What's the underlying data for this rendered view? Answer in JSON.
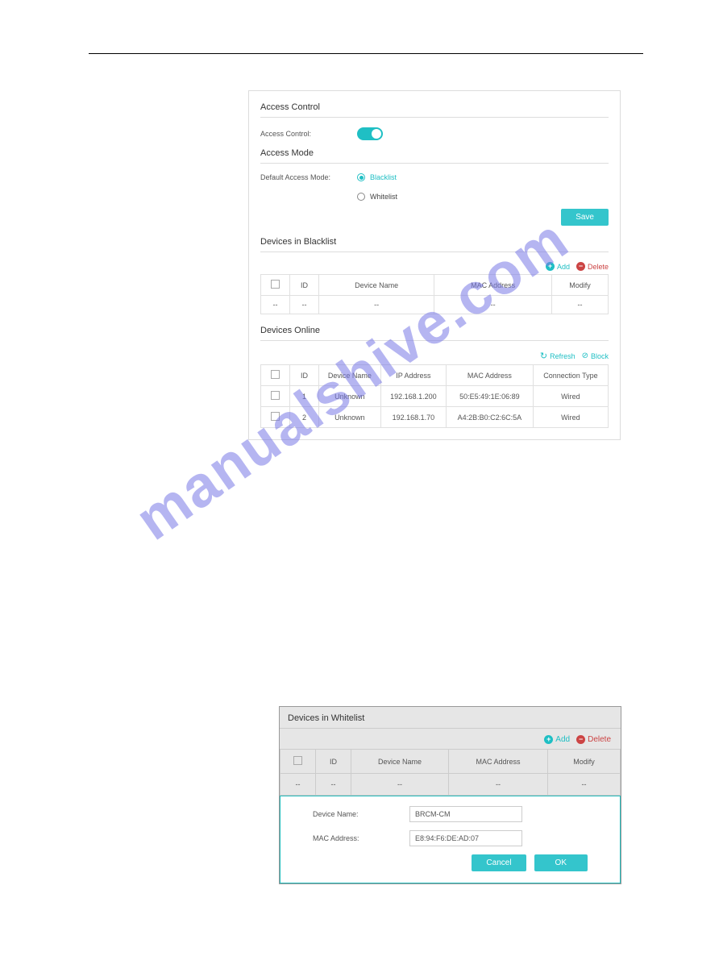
{
  "watermark": "manualshive.com",
  "panel1": {
    "sections": {
      "access_control_title": "Access Control",
      "access_control_label": "Access Control:",
      "access_mode_title": "Access Mode",
      "default_mode_label": "Default Access Mode:",
      "radios": {
        "blacklist": "Blacklist",
        "whitelist": "Whitelist"
      },
      "save": "Save"
    },
    "blacklist": {
      "title": "Devices in Blacklist",
      "add": "Add",
      "delete": "Delete",
      "headers": {
        "id": "ID",
        "device": "Device Name",
        "mac": "MAC Address",
        "modify": "Modify"
      },
      "empty": "--"
    },
    "online": {
      "title": "Devices Online",
      "refresh": "Refresh",
      "block": "Block",
      "headers": {
        "id": "ID",
        "device": "Device Name",
        "ip": "IP Address",
        "mac": "MAC Address",
        "conn": "Connection Type"
      },
      "rows": [
        {
          "id": "1",
          "device": "Unknown",
          "ip": "192.168.1.200",
          "mac": "50:E5:49:1E:06:89",
          "conn": "Wired"
        },
        {
          "id": "2",
          "device": "Unknown",
          "ip": "192.168.1.70",
          "mac": "A4:2B:B0:C2:6C:5A",
          "conn": "Wired"
        }
      ]
    }
  },
  "panel2": {
    "title": "Devices in Whitelist",
    "add": "Add",
    "delete": "Delete",
    "headers": {
      "id": "ID",
      "device": "Device Name",
      "mac": "MAC Address",
      "modify": "Modify"
    },
    "empty": "--",
    "form": {
      "device_label": "Device Name:",
      "device_value": "BRCM-CM",
      "mac_label": "MAC Address:",
      "mac_value": "E8:94:F6:DE:AD:07",
      "cancel": "Cancel",
      "ok": "OK"
    }
  }
}
